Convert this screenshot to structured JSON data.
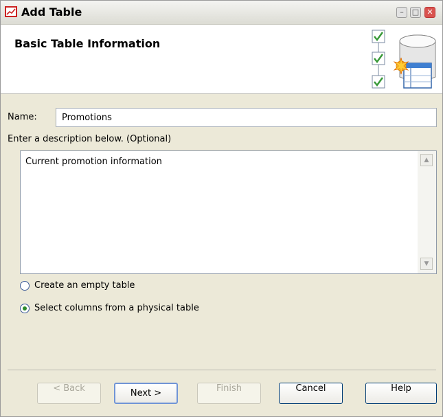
{
  "window": {
    "title": "Add Table"
  },
  "header": {
    "title": "Basic Table Information"
  },
  "form": {
    "name_label": "Name:",
    "name_value": "Promotions",
    "description_prompt": "Enter a description below. (Optional)",
    "description_value": "Current promotion information",
    "options": [
      {
        "label": "Create an empty table",
        "selected": false
      },
      {
        "label": "Select columns from a physical table",
        "selected": true
      }
    ]
  },
  "buttons": {
    "back": "< Back",
    "next": "Next >",
    "finish": "Finish",
    "cancel": "Cancel",
    "help": "Help"
  },
  "colors": {
    "accent": "#3a9a3a",
    "close": "#d9534f",
    "default_border": "#7094d6"
  }
}
